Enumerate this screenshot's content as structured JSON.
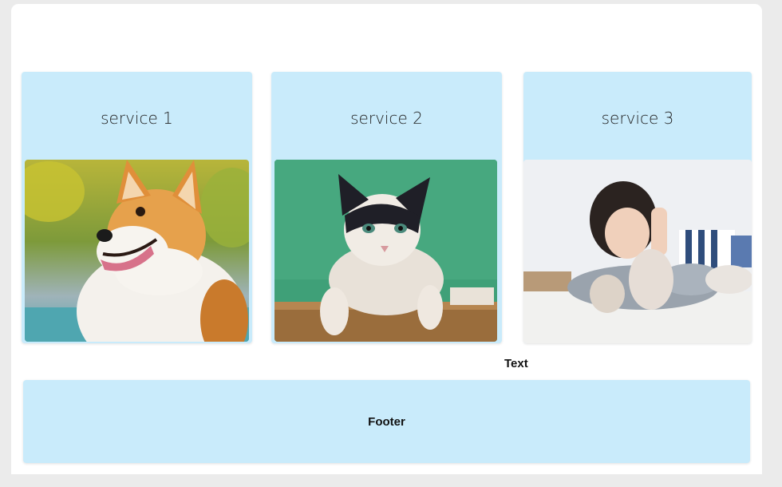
{
  "services": [
    {
      "title": "service 1",
      "image": "corgi-dog-photo"
    },
    {
      "title": "service 2",
      "image": "cat-on-box-photo"
    },
    {
      "title": "service 3",
      "image": "woman-with-cats-photo"
    }
  ],
  "text_label": "Text",
  "footer": {
    "label": "Footer"
  },
  "colors": {
    "card_bg": "#c9ebfb",
    "page_bg": "#ffffff",
    "outer_bg": "#ebebeb"
  }
}
